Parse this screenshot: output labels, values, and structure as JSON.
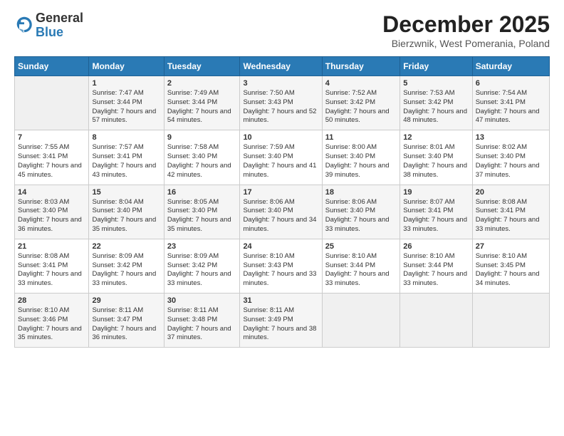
{
  "header": {
    "logo_general": "General",
    "logo_blue": "Blue",
    "month_title": "December 2025",
    "location": "Bierzwnik, West Pomerania, Poland"
  },
  "days_of_week": [
    "Sunday",
    "Monday",
    "Tuesday",
    "Wednesday",
    "Thursday",
    "Friday",
    "Saturday"
  ],
  "weeks": [
    [
      {
        "day": "",
        "empty": true
      },
      {
        "day": "1",
        "sunrise": "7:47 AM",
        "sunset": "3:44 PM",
        "daylight": "7 hours and 57 minutes."
      },
      {
        "day": "2",
        "sunrise": "7:49 AM",
        "sunset": "3:44 PM",
        "daylight": "7 hours and 54 minutes."
      },
      {
        "day": "3",
        "sunrise": "7:50 AM",
        "sunset": "3:43 PM",
        "daylight": "7 hours and 52 minutes."
      },
      {
        "day": "4",
        "sunrise": "7:52 AM",
        "sunset": "3:42 PM",
        "daylight": "7 hours and 50 minutes."
      },
      {
        "day": "5",
        "sunrise": "7:53 AM",
        "sunset": "3:42 PM",
        "daylight": "7 hours and 48 minutes."
      },
      {
        "day": "6",
        "sunrise": "7:54 AM",
        "sunset": "3:41 PM",
        "daylight": "7 hours and 47 minutes."
      }
    ],
    [
      {
        "day": "7",
        "sunrise": "7:55 AM",
        "sunset": "3:41 PM",
        "daylight": "7 hours and 45 minutes."
      },
      {
        "day": "8",
        "sunrise": "7:57 AM",
        "sunset": "3:41 PM",
        "daylight": "7 hours and 43 minutes."
      },
      {
        "day": "9",
        "sunrise": "7:58 AM",
        "sunset": "3:40 PM",
        "daylight": "7 hours and 42 minutes."
      },
      {
        "day": "10",
        "sunrise": "7:59 AM",
        "sunset": "3:40 PM",
        "daylight": "7 hours and 41 minutes."
      },
      {
        "day": "11",
        "sunrise": "8:00 AM",
        "sunset": "3:40 PM",
        "daylight": "7 hours and 39 minutes."
      },
      {
        "day": "12",
        "sunrise": "8:01 AM",
        "sunset": "3:40 PM",
        "daylight": "7 hours and 38 minutes."
      },
      {
        "day": "13",
        "sunrise": "8:02 AM",
        "sunset": "3:40 PM",
        "daylight": "7 hours and 37 minutes."
      }
    ],
    [
      {
        "day": "14",
        "sunrise": "8:03 AM",
        "sunset": "3:40 PM",
        "daylight": "7 hours and 36 minutes."
      },
      {
        "day": "15",
        "sunrise": "8:04 AM",
        "sunset": "3:40 PM",
        "daylight": "7 hours and 35 minutes."
      },
      {
        "day": "16",
        "sunrise": "8:05 AM",
        "sunset": "3:40 PM",
        "daylight": "7 hours and 35 minutes."
      },
      {
        "day": "17",
        "sunrise": "8:06 AM",
        "sunset": "3:40 PM",
        "daylight": "7 hours and 34 minutes."
      },
      {
        "day": "18",
        "sunrise": "8:06 AM",
        "sunset": "3:40 PM",
        "daylight": "7 hours and 33 minutes."
      },
      {
        "day": "19",
        "sunrise": "8:07 AM",
        "sunset": "3:41 PM",
        "daylight": "7 hours and 33 minutes."
      },
      {
        "day": "20",
        "sunrise": "8:08 AM",
        "sunset": "3:41 PM",
        "daylight": "7 hours and 33 minutes."
      }
    ],
    [
      {
        "day": "21",
        "sunrise": "8:08 AM",
        "sunset": "3:41 PM",
        "daylight": "7 hours and 33 minutes."
      },
      {
        "day": "22",
        "sunrise": "8:09 AM",
        "sunset": "3:42 PM",
        "daylight": "7 hours and 33 minutes."
      },
      {
        "day": "23",
        "sunrise": "8:09 AM",
        "sunset": "3:42 PM",
        "daylight": "7 hours and 33 minutes."
      },
      {
        "day": "24",
        "sunrise": "8:10 AM",
        "sunset": "3:43 PM",
        "daylight": "7 hours and 33 minutes."
      },
      {
        "day": "25",
        "sunrise": "8:10 AM",
        "sunset": "3:44 PM",
        "daylight": "7 hours and 33 minutes."
      },
      {
        "day": "26",
        "sunrise": "8:10 AM",
        "sunset": "3:44 PM",
        "daylight": "7 hours and 33 minutes."
      },
      {
        "day": "27",
        "sunrise": "8:10 AM",
        "sunset": "3:45 PM",
        "daylight": "7 hours and 34 minutes."
      }
    ],
    [
      {
        "day": "28",
        "sunrise": "8:10 AM",
        "sunset": "3:46 PM",
        "daylight": "7 hours and 35 minutes."
      },
      {
        "day": "29",
        "sunrise": "8:11 AM",
        "sunset": "3:47 PM",
        "daylight": "7 hours and 36 minutes."
      },
      {
        "day": "30",
        "sunrise": "8:11 AM",
        "sunset": "3:48 PM",
        "daylight": "7 hours and 37 minutes."
      },
      {
        "day": "31",
        "sunrise": "8:11 AM",
        "sunset": "3:49 PM",
        "daylight": "7 hours and 38 minutes."
      },
      {
        "day": "",
        "empty": true
      },
      {
        "day": "",
        "empty": true
      },
      {
        "day": "",
        "empty": true
      }
    ]
  ]
}
